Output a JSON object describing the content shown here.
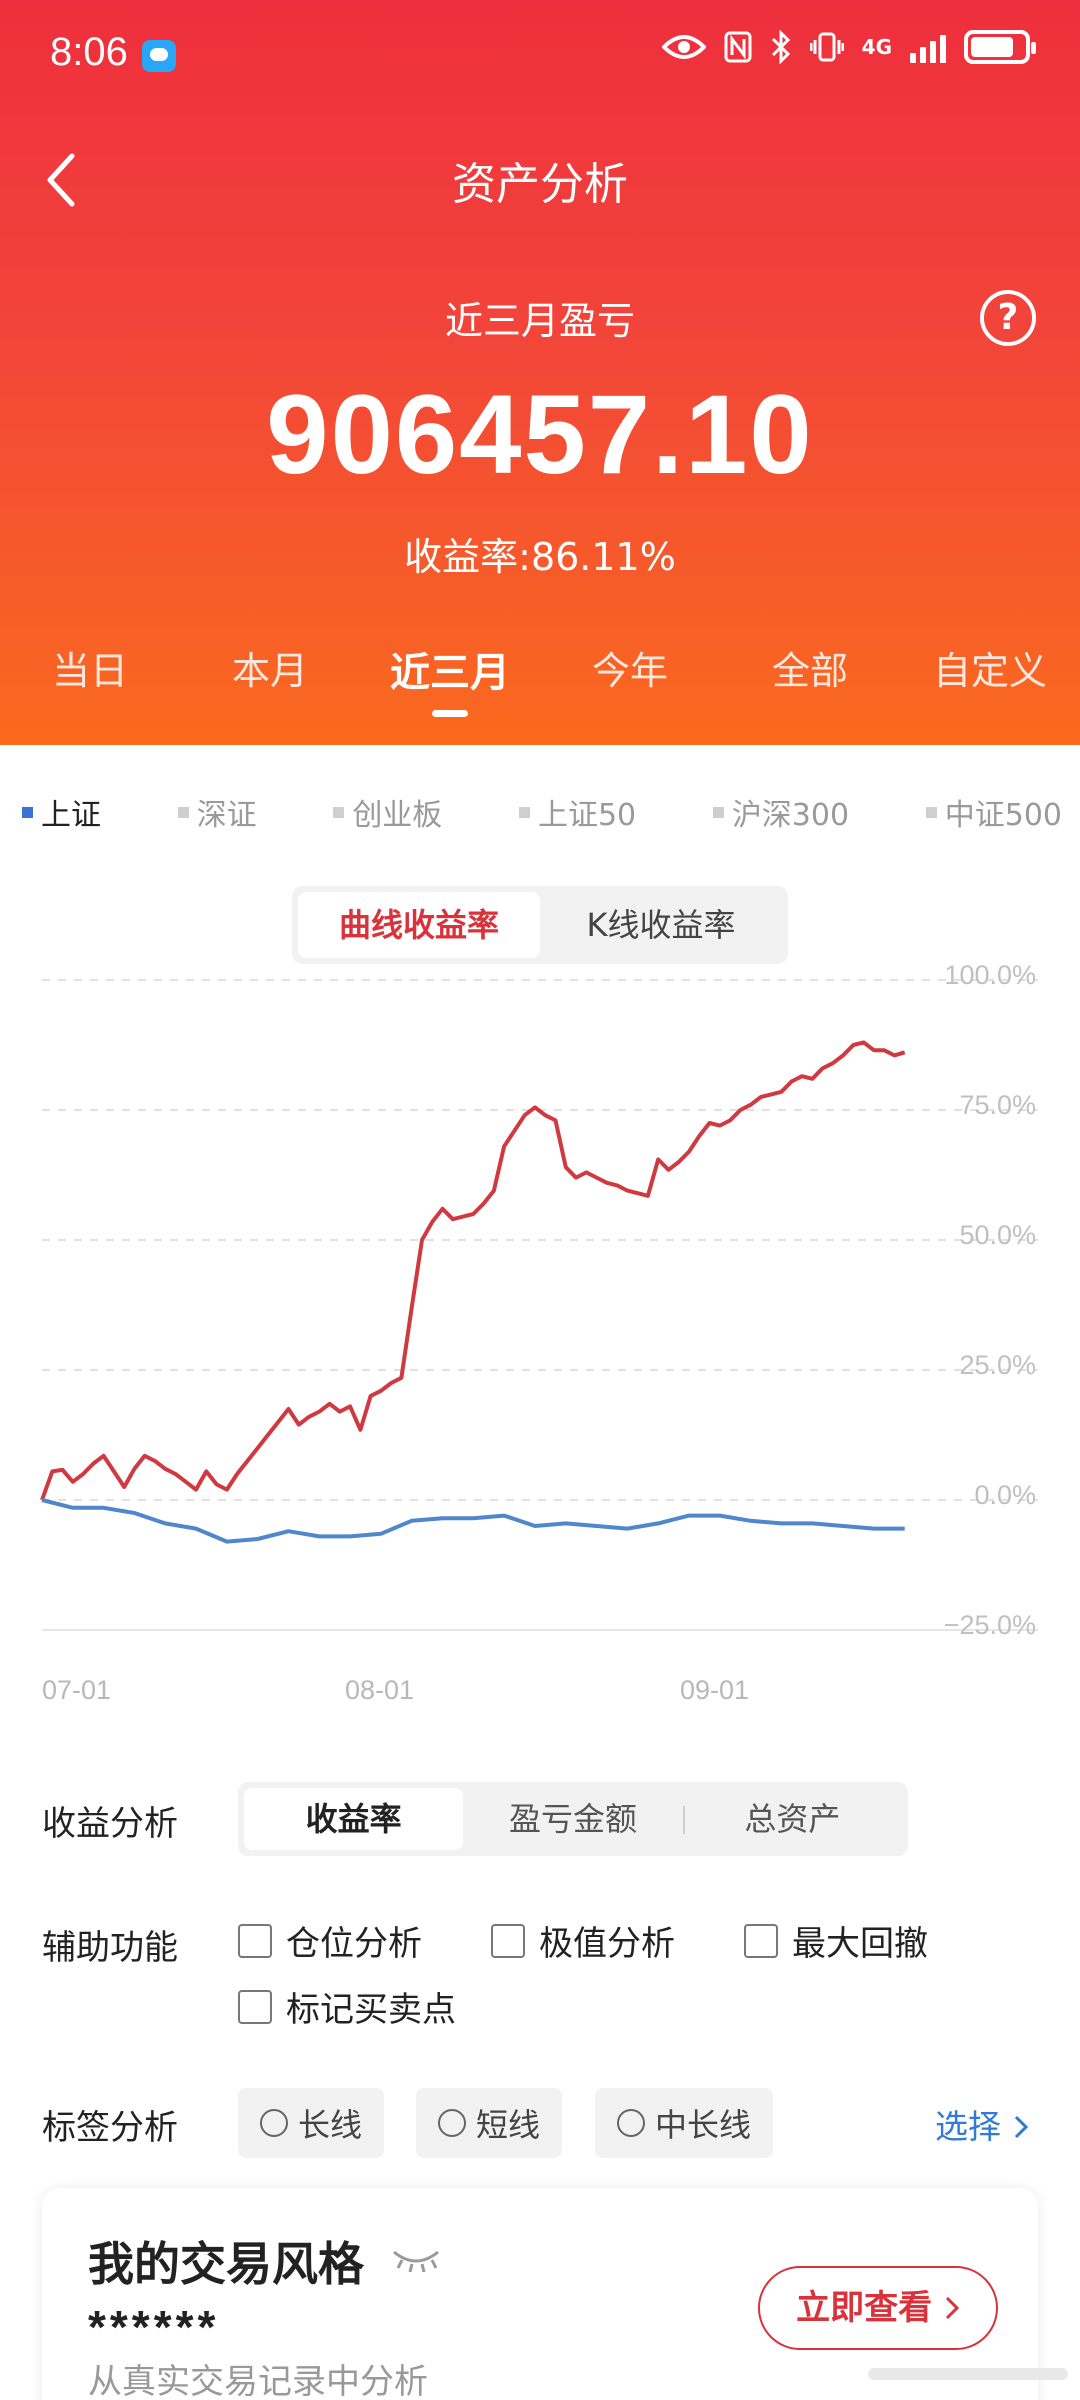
{
  "status_bar": {
    "time": "8:06",
    "network": "4G"
  },
  "header": {
    "title": "资产分析",
    "subtitle": "近三月盈亏",
    "amount": "906457.10",
    "yield_text": "收益率:86.11%",
    "help_symbol": "?"
  },
  "period_tabs": [
    "当日",
    "本月",
    "近三月",
    "今年",
    "全部",
    "自定义"
  ],
  "period_active": "近三月",
  "index_tabs": [
    "上证",
    "深证",
    "创业板",
    "上证50",
    "沪深300",
    "中证500"
  ],
  "index_active": "上证",
  "chart_toggle": {
    "options": [
      "曲线收益率",
      "K线收益率"
    ],
    "active": "曲线收益率"
  },
  "chart_data": {
    "type": "line",
    "title": "",
    "xlabel": "",
    "ylabel": "",
    "x_ticks": [
      "07-01",
      "08-01",
      "09-01"
    ],
    "y_ticks": [
      "100.0%",
      "75.0%",
      "50.0%",
      "25.0%",
      "0.0%",
      "−25.0%"
    ],
    "ylim": [
      -25,
      100
    ],
    "grid": true,
    "series": [
      {
        "color": "#d0393f",
        "x": [
          "07-01",
          "07-02",
          "07-03",
          "07-04",
          "07-05",
          "07-06",
          "07-07",
          "07-08",
          "07-09",
          "07-10",
          "07-11",
          "07-12",
          "07-13",
          "07-14",
          "07-15",
          "07-16",
          "07-17",
          "07-18",
          "07-19",
          "07-20",
          "07-21",
          "07-22",
          "07-23",
          "07-24",
          "07-25",
          "07-26",
          "07-27",
          "07-28",
          "07-29",
          "07-30",
          "07-31",
          "08-01",
          "08-02",
          "08-03",
          "08-04",
          "08-05",
          "08-06",
          "08-07",
          "08-08",
          "08-09",
          "08-10",
          "08-11",
          "08-12",
          "08-13",
          "08-14",
          "08-15",
          "08-16",
          "08-17",
          "08-18",
          "08-19",
          "08-20",
          "08-21",
          "08-22",
          "08-23",
          "08-24",
          "08-25",
          "08-26",
          "08-27",
          "08-28",
          "08-29",
          "08-30",
          "08-31",
          "09-01",
          "09-02",
          "09-03",
          "09-04",
          "09-05",
          "09-06",
          "09-07",
          "09-08",
          "09-09",
          "09-10",
          "09-11",
          "09-12",
          "09-13",
          "09-14",
          "09-15",
          "09-16",
          "09-17",
          "09-18",
          "09-19",
          "09-20",
          "09-21",
          "09-22",
          "09-23"
        ],
        "values": [
          0.0,
          5.5,
          5.8,
          3.5,
          5.0,
          7.0,
          8.5,
          5.5,
          2.5,
          6.0,
          8.5,
          7.5,
          6.0,
          5.0,
          3.5,
          2.0,
          5.5,
          3.0,
          2.0,
          5.0,
          7.5,
          10.0,
          12.5,
          15.0,
          17.5,
          14.5,
          16.0,
          17.0,
          18.5,
          17.0,
          18.0,
          13.5,
          20.0,
          21.0,
          22.5,
          23.5,
          37.0,
          50.0,
          53.5,
          56.0,
          54.0,
          54.5,
          55.0,
          57.0,
          59.5,
          68.0,
          71.0,
          74.0,
          75.5,
          74.0,
          73.0,
          64.0,
          62.0,
          63.0,
          62.0,
          61.0,
          60.5,
          59.5,
          59.0,
          58.5,
          65.5,
          63.5,
          65.0,
          67.0,
          70.0,
          72.5,
          72.0,
          73.0,
          75.0,
          76.0,
          77.5,
          78.0,
          78.5,
          80.5,
          81.5,
          81.0,
          83.0,
          84.0,
          85.5,
          87.5,
          88.0,
          86.5,
          86.5,
          85.5,
          86.1
        ]
      },
      {
        "color": "#4f86cc",
        "x": [
          "07-01",
          "07-04",
          "07-07",
          "07-10",
          "07-13",
          "07-16",
          "07-19",
          "07-22",
          "07-25",
          "07-28",
          "07-31",
          "08-03",
          "08-06",
          "08-09",
          "08-12",
          "08-15",
          "08-18",
          "08-21",
          "08-24",
          "08-27",
          "08-30",
          "09-02",
          "09-05",
          "09-08",
          "09-11",
          "09-14",
          "09-17",
          "09-20",
          "09-23"
        ],
        "values": [
          0.0,
          -1.5,
          -1.5,
          -2.5,
          -4.5,
          -5.5,
          -8.0,
          -7.5,
          -6.0,
          -7.0,
          -7.0,
          -6.5,
          -4.0,
          -3.5,
          -3.5,
          -3.0,
          -5.0,
          -4.5,
          -5.0,
          -5.5,
          -4.5,
          -3.0,
          -3.0,
          -4.0,
          -4.5,
          -4.5,
          -5.0,
          -5.5,
          -5.5
        ]
      }
    ]
  },
  "analysis": {
    "label": "收益分析",
    "options": [
      "收益率",
      "盈亏金额",
      "总资产"
    ],
    "active": "收益率"
  },
  "aux": {
    "label": "辅助功能",
    "items": [
      "仓位分析",
      "极值分析",
      "最大回撤",
      "标记买卖点"
    ]
  },
  "tags": {
    "label": "标签分析",
    "items": [
      "长线",
      "短线",
      "中长线"
    ],
    "select_label": "选择"
  },
  "style_card": {
    "title": "我的交易风格",
    "masked_value": "******",
    "description": "从真实交易记录中分析",
    "button_label": "立即查看"
  }
}
